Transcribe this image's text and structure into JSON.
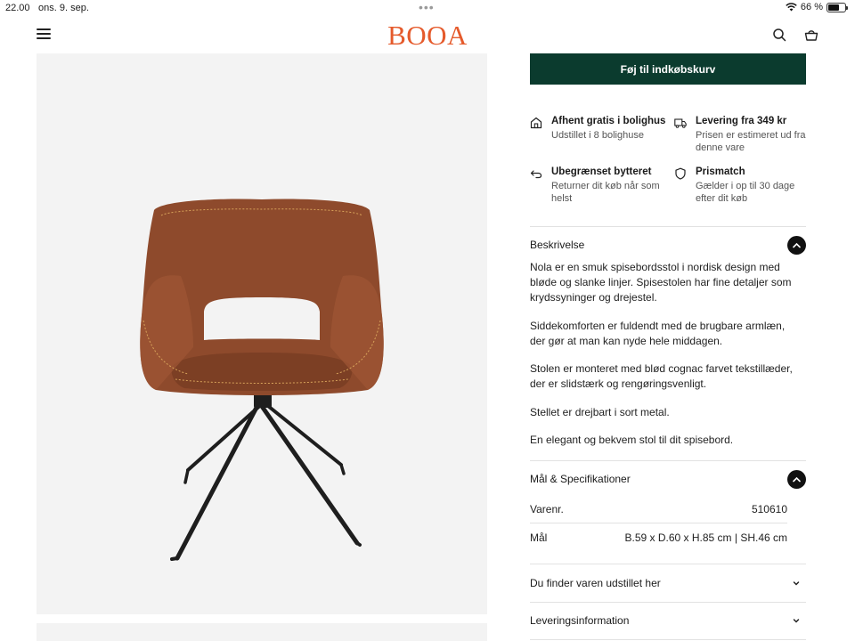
{
  "status_bar": {
    "time": "22.00",
    "date": "ons. 9. sep.",
    "battery": "66 %",
    "battery_level": 0.66
  },
  "header": {
    "logo": "BOOA",
    "menu_icon": "hamburger-menu-icon",
    "search_icon": "search-icon",
    "cart_icon": "basket-icon"
  },
  "product": {
    "image_alt": "Nola spisebordsstol i cognac læder med sort drejestel",
    "add_to_cart_label": "Føj til indkøbskurv",
    "brand_color": "#e55a2b",
    "button_color": "#0b3b2e"
  },
  "features": [
    {
      "icon": "store-icon",
      "title": "Afhent gratis i bolighus",
      "desc": "Udstillet i 8 bolighuse"
    },
    {
      "icon": "truck-icon",
      "title": "Levering fra 349 kr",
      "desc": "Prisen er estimeret ud fra denne vare"
    },
    {
      "icon": "return-arrow-icon",
      "title": "Ubegrænset bytteret",
      "desc": "Returner dit køb når som helst"
    },
    {
      "icon": "shield-icon",
      "title": "Prismatch",
      "desc": "Gælder i op til 30 dage efter dit køb"
    }
  ],
  "description": {
    "title": "Beskrivelse",
    "paragraphs": [
      "Nola er en smuk spisebordsstol i nordisk design med bløde og slanke linjer. Spisestolen har fine detaljer som krydssyninger og drejestel.",
      "Siddekomforten er fuldendt med de brugbare armlæn, der gør at man kan nyde hele middagen.",
      "Stolen er monteret med blød cognac farvet tekstillæder, der er slidstærk og rengøringsvenligt.",
      "Stellet er drejbart i sort metal.",
      "En elegant og bekvem stol til dit spisebord."
    ]
  },
  "specs": {
    "title": "Mål & Specifikationer",
    "rows": [
      {
        "label": "Varenr.",
        "value": "510610"
      },
      {
        "label": "Mål",
        "value": "B.59 x D.60 x H.85 cm | SH.46 cm"
      }
    ]
  },
  "accordions": [
    {
      "title": "Du finder varen udstillet her"
    },
    {
      "title": "Leveringsinformation"
    }
  ]
}
